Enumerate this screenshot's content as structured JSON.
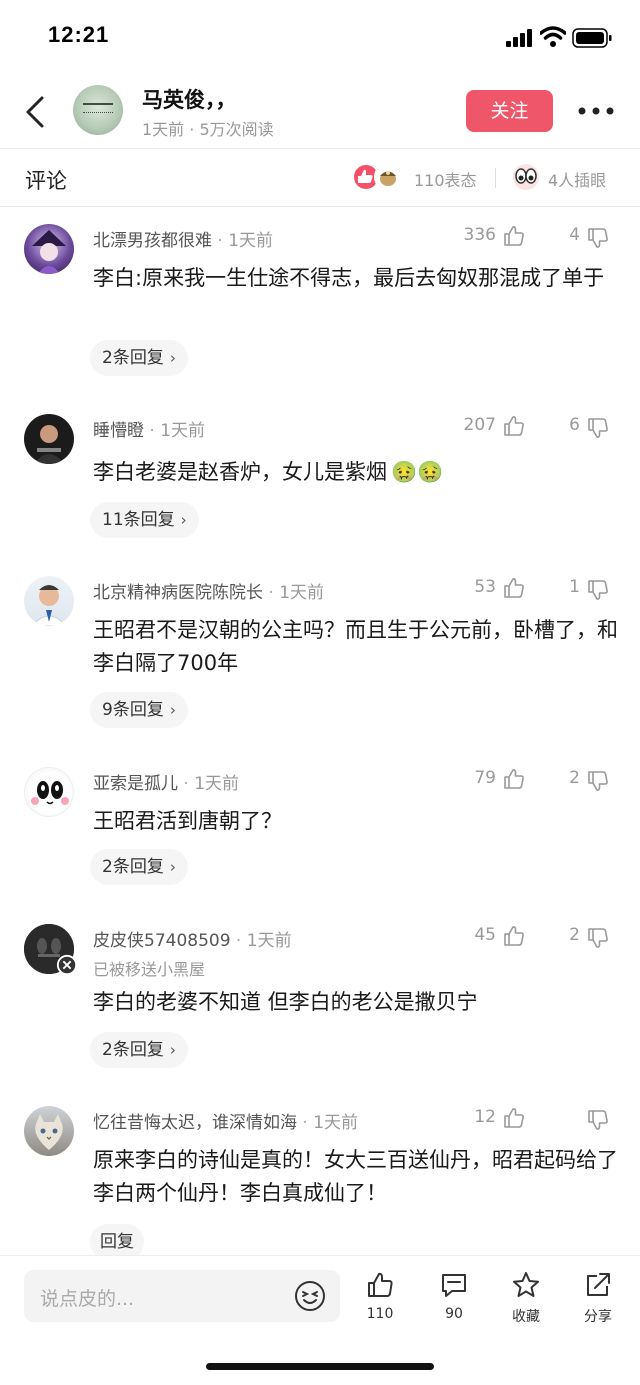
{
  "status_bar": {
    "time": "12:21"
  },
  "header": {
    "author": "马英俊，，",
    "meta": "1天前 · 5万次阅读",
    "follow_label": "关注"
  },
  "comments_header": {
    "title": "评论",
    "reactions_label": "110表态",
    "insert_label": "4人插眼"
  },
  "comments": [
    {
      "user": "北漂男孩都很难",
      "time": "1天前",
      "likes": "336",
      "dislikes": "4",
      "text": "李白:原来我一生仕途不得志，最后去匈奴那混成了单于",
      "replies": "2条回复"
    },
    {
      "user": "睡懵瞪",
      "time": "1天前",
      "likes": "207",
      "dislikes": "6",
      "text": "李白老婆是赵香炉，女儿是紫烟",
      "emoji": "🤢🤢",
      "replies": "11条回复"
    },
    {
      "user": "北京精神病医院陈院长",
      "time": "1天前",
      "likes": "53",
      "dislikes": "1",
      "text": "王昭君不是汉朝的公主吗？而且生于公元前，卧槽了，和李白隔了700年",
      "replies": "9条回复"
    },
    {
      "user": "亚索是孤儿",
      "time": "1天前",
      "likes": "79",
      "dislikes": "2",
      "text": "王昭君活到唐朝了？",
      "replies": "2条回复"
    },
    {
      "user": "皮皮侠57408509",
      "time": "1天前",
      "sub": "已被移送小黑屋",
      "likes": "45",
      "dislikes": "2",
      "text": "李白的老婆不知道 但李白的老公是撒贝宁",
      "replies": "2条回复"
    },
    {
      "user": "忆往昔悔太迟，谁深情如海",
      "time": "1天前",
      "likes": "12",
      "dislikes": "",
      "text": "原来李白的诗仙是真的！女大三百送仙丹，昭君起码给了李白两个仙丹！李白真成仙了！",
      "replies": "回复"
    }
  ],
  "bottom_bar": {
    "placeholder": "说点皮的...",
    "like_count": "110",
    "comment_count": "90",
    "favorite_label": "收藏",
    "share_label": "分享"
  }
}
